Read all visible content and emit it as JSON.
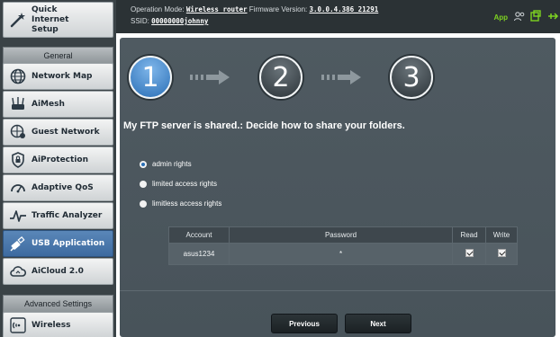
{
  "sidebar": {
    "quick_setup": "Quick Internet Setup",
    "general_header": "General",
    "items": [
      {
        "label": "Network Map"
      },
      {
        "label": "AiMesh"
      },
      {
        "label": "Guest Network"
      },
      {
        "label": "AiProtection"
      },
      {
        "label": "Adaptive QoS"
      },
      {
        "label": "Traffic Analyzer"
      },
      {
        "label": "USB Application"
      },
      {
        "label": "AiCloud 2.0"
      }
    ],
    "advanced_header": "Advanced Settings",
    "advanced_items": [
      {
        "label": "Wireless"
      }
    ],
    "active": "USB Application"
  },
  "topbar": {
    "op_mode_label": "Operation Mode:",
    "op_mode_value": "Wireless router",
    "fw_label": "Firmware Version:",
    "fw_value": "3.0.0.4.386_21291",
    "ssid_label": "SSID:",
    "ssid_value": "00000000johnny",
    "app_label": "App"
  },
  "wizard": {
    "steps": [
      "1",
      "2",
      "3"
    ],
    "current_step": 1,
    "headline": "My FTP server is shared.: Decide how to share your folders.",
    "options": [
      {
        "label": "admin rights",
        "selected": true
      },
      {
        "label": "limited access rights",
        "selected": false
      },
      {
        "label": "limitless access rights",
        "selected": false
      }
    ],
    "table": {
      "headers": [
        "Account",
        "Password",
        "Read",
        "Write"
      ],
      "rows": [
        {
          "account": "asus1234",
          "password": "*",
          "read": true,
          "write": true
        }
      ]
    },
    "buttons": {
      "previous": "Previous",
      "next": "Next"
    }
  },
  "colors": {
    "accent": "#2a6fb6",
    "active_item": "#4a78ae",
    "panel": "#4f5a61",
    "app_green": "#7ed321"
  }
}
